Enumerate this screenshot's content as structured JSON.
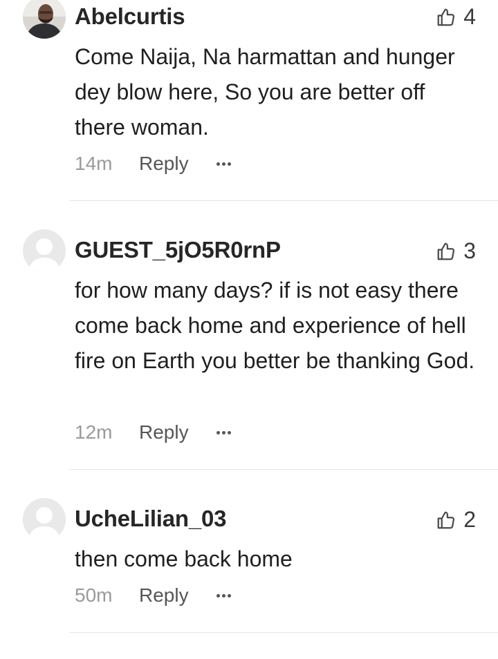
{
  "comments": [
    {
      "username": "Abelcurtis",
      "likes": "4",
      "text": "Come Naija, Na harmattan and hunger dey blow here, So you are better off there woman.",
      "time": "14m",
      "reply_label": "Reply",
      "avatar": "photo"
    },
    {
      "username": "GUEST_5jO5R0rnP",
      "likes": "3",
      "text": "for how many days? if is not easy there come back home and experience of hell fire on Earth you better be thanking God.",
      "time": "12m",
      "reply_label": "Reply",
      "avatar": "default"
    },
    {
      "username": "UcheLilian_03",
      "likes": "2",
      "text": "then come back home",
      "time": "50m",
      "reply_label": "Reply",
      "avatar": "default"
    }
  ],
  "icons": {
    "like": "thumbs-up-outline-icon",
    "more": "more-horizontal-icon",
    "avatar_default": "default-user-avatar"
  },
  "colors": {
    "username": "#262626",
    "text": "#1f1f1f",
    "time": "#9a9a9a",
    "reply": "#555555",
    "divider": "#e5e5e5",
    "avatar_bg": "#e9e9e9"
  }
}
